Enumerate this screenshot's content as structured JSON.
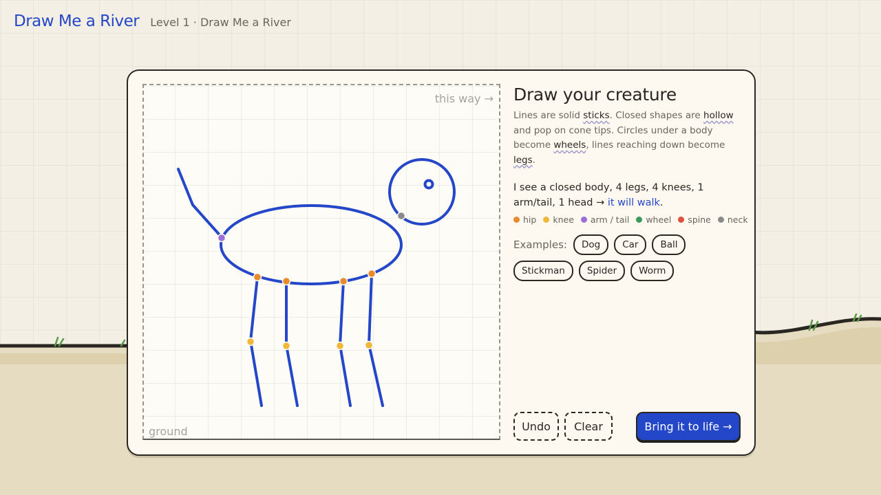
{
  "header": {
    "app_title": "Draw Me a River",
    "level_label": "Level 1 · Draw Me a River"
  },
  "canvas": {
    "direction_hint": "this way →",
    "ground_label": "ground"
  },
  "panel": {
    "title": "Draw your creature",
    "desc_1": "Lines are solid ",
    "kw_sticks": "sticks",
    "desc_2": ". Closed shapes are ",
    "kw_hollow": "hollow",
    "desc_3": " and pop on cone tips. Circles under a body become ",
    "kw_wheels": "wheels",
    "desc_4": ", lines reaching down become ",
    "kw_legs": "legs",
    "desc_5": ".",
    "status_prefix": "I see a closed body, 4 legs, 4 knees, 1 arm/tail, 1 head → ",
    "status_result": "it will walk",
    "status_suffix": ".",
    "legend": [
      {
        "label": "hip",
        "color": "#e88a2e"
      },
      {
        "label": "knee",
        "color": "#f0b83a"
      },
      {
        "label": "arm / tail",
        "color": "#9b6fd6"
      },
      {
        "label": "wheel",
        "color": "#3a9a5a"
      },
      {
        "label": "spine",
        "color": "#e0503c"
      },
      {
        "label": "neck",
        "color": "#8a8a8a"
      }
    ],
    "examples_label": "Examples:",
    "examples": [
      "Dog",
      "Car",
      "Ball",
      "Stickman",
      "Spider",
      "Worm"
    ]
  },
  "actions": {
    "undo": "Undo",
    "clear": "Clear",
    "bring_to_life": "Bring it to life →"
  },
  "colors": {
    "accent": "#2446c9",
    "stroke": "#2446c9",
    "ink": "#2a2622",
    "paper": "#fdf9f1"
  }
}
